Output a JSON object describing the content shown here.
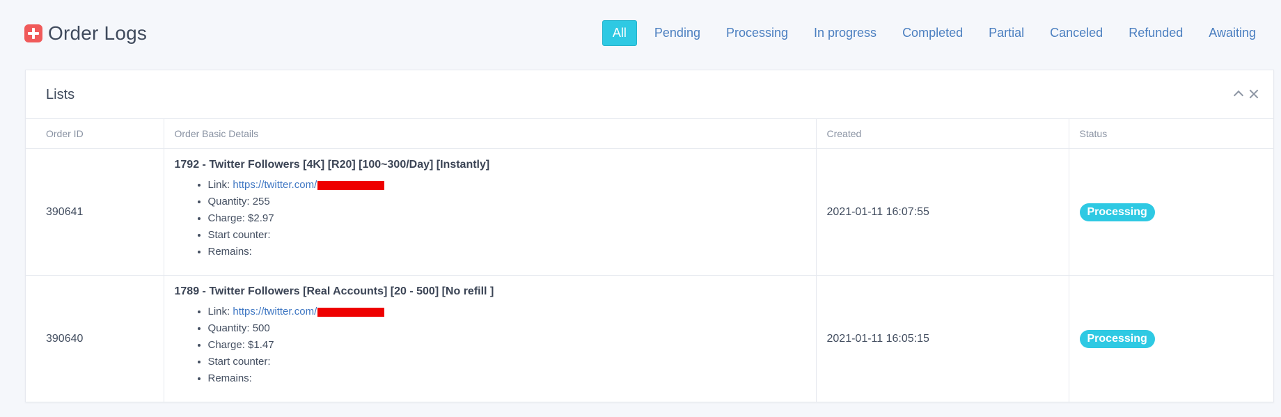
{
  "header": {
    "title": "Order Logs",
    "filters": [
      "All",
      "Pending",
      "Processing",
      "In progress",
      "Completed",
      "Partial",
      "Canceled",
      "Refunded",
      "Awaiting"
    ],
    "active_filter": "All"
  },
  "card": {
    "title": "Lists",
    "columns": [
      "Order ID",
      "Order Basic Details",
      "Created",
      "Status"
    ],
    "rows": [
      {
        "id": "390641",
        "name": "1792 - Twitter Followers [4K] [R20] [100~300/Day] [Instantly]",
        "link_label": "Link:",
        "link": "https://twitter.com/",
        "quantity": "Quantity: 255",
        "charge": "Charge: $2.97",
        "start_counter": "Start counter:",
        "remains": "Remains:",
        "created": "2021-01-11 16:07:55",
        "status": "Processing"
      },
      {
        "id": "390640",
        "name": "1789 - Twitter Followers [Real Accounts] [20 - 500] [No refill ]",
        "link_label": "Link:",
        "link": "https://twitter.com/",
        "quantity": "Quantity: 500",
        "charge": "Charge: $1.47",
        "start_counter": "Start counter:",
        "remains": "Remains:",
        "created": "2021-01-11 16:05:15",
        "status": "Processing"
      }
    ]
  },
  "colors": {
    "accent": "#2ec9e3",
    "link": "#3f77c3",
    "logo": "#f05a5a",
    "redaction": "#ee0000"
  },
  "icons": {
    "logo": "plus-square-icon",
    "collapse": "chevron-up-icon",
    "close": "close-icon"
  }
}
